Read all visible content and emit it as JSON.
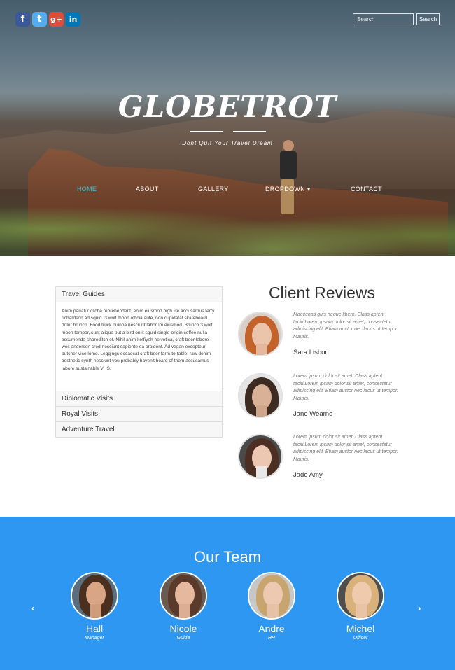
{
  "social": {
    "facebook": "f",
    "twitter": "t",
    "googleplus": "g+",
    "linkedin": "in"
  },
  "search": {
    "placeholder": "Search",
    "button": "Search"
  },
  "hero": {
    "logo": "GLOBETROT",
    "tagline": "Dont Quit Your Travel Dream"
  },
  "nav": {
    "home": "HOME",
    "about": "ABOUT",
    "gallery": "GALLERY",
    "dropdown": "DROPDOWN",
    "contact": "CONTACT"
  },
  "accordion": {
    "travel_guides": "Travel Guides",
    "travel_guides_body": "Anim pariatur cliche reprehenderit, enim eiusmod high life accusamus terry richardson ad squid. 3 wolf moon officia aute, non cupidatat skateboard dolor brunch. Food truck quinoa nesciunt laborum eiusmod. Brunch 3 wolf moon tempor, sunt aliqua put a bird on it squid single-origin coffee nulla assumenda shoreditch et. Nihil anim keffiyeh helvetica, craft beer labore wes anderson cred nesciunt sapiente ea proident. Ad vegan excepteur butcher vice lomo. Leggings occaecat craft beer farm-to-table, raw denim aesthetic synth nesciunt you probably haven't heard of them accusamus labore sustainable VHS.",
    "diplomatic": "Diplomatic Visits",
    "royal": "Royal Visits",
    "adventure": "Adventure Travel"
  },
  "reviews": {
    "title": "Client Reviews",
    "items": [
      {
        "text": "Maecenas quis neque libero. Class aptent taciti.Lorem ipsum dolor sit amet, consectetur adipiscing elit. Etiam auctor nec lacus ut tempor. Mauris.",
        "name": "Sara Lisbon"
      },
      {
        "text": "Lorem ipsum dolor sit amet. Class aptent taciti.Lorem ipsum dolor sit amet, consectetur adipiscing elit. Etiam auctor nec lacus ut tempor. Mauris.",
        "name": "Jane Wearne"
      },
      {
        "text": "Lorem ipsum dolor sit amet. Class aptent taciti.Lorem ipsum dolor sit amet, consectetur adipiscing elit. Etiam auctor nec lacus ut tempor. Mauris.",
        "name": "Jade Amy"
      }
    ]
  },
  "team": {
    "title": "Our Team",
    "prev": "‹",
    "next": "›",
    "members": [
      {
        "name": "Hall",
        "role": "Manager"
      },
      {
        "name": "Nicole",
        "role": "Guide"
      },
      {
        "name": "Andre",
        "role": "HR"
      },
      {
        "name": "Michel",
        "role": "Officer"
      }
    ]
  },
  "colors": {
    "accent": "#29c1e0",
    "team_bg": "#2e97f2"
  }
}
